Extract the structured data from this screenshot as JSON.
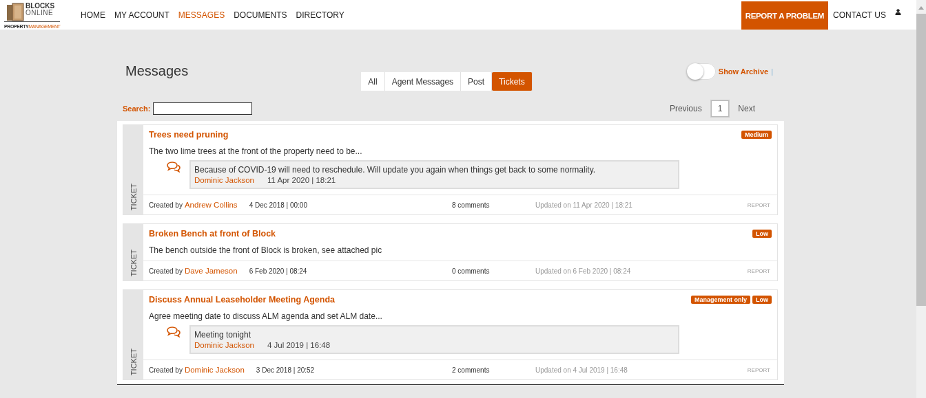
{
  "logo": {
    "name_line_1": "BLOCKS",
    "name_line_2": "ONLINE",
    "tagline_part_1": "PROPERTY",
    "tagline_part_2": "MANAGEMENT"
  },
  "nav": [
    {
      "label": "HOME",
      "selected": false
    },
    {
      "label": "MY ACCOUNT",
      "selected": false
    },
    {
      "label": "MESSAGES",
      "selected": true
    },
    {
      "label": "DOCUMENTS",
      "selected": false
    },
    {
      "label": "DIRECTORY",
      "selected": false
    }
  ],
  "header_actions": {
    "report": "REPORT A PROBLEM",
    "contact": "CONTACT US"
  },
  "page_title": "Messages",
  "archive_toggle": {
    "label": "Show Archive",
    "separator": "|",
    "on": false
  },
  "tabs": [
    {
      "label": "All",
      "selected": false
    },
    {
      "label": "Agent Messages",
      "selected": false
    },
    {
      "label": "Post",
      "selected": false
    },
    {
      "label": "Tickets",
      "selected": true
    }
  ],
  "search": {
    "label": "Search:"
  },
  "pagination": {
    "previous": "Previous",
    "next": "Next",
    "pages": [
      {
        "label": "1",
        "selected": true
      }
    ]
  },
  "tickets": [
    {
      "type_label": "TICKET",
      "title": "Trees need pruning",
      "badges": [
        "Medium"
      ],
      "summary": "The two lime trees at the front of the property need to be...",
      "latest_comment": {
        "text": "Because of COVID-19 will need to reschedule. Will update you again when things get back to some normality.",
        "author": "Dominic Jackson",
        "date": "11 Apr 2020 | 18:21"
      },
      "created_prefix": "Created by",
      "created_by": "Andrew Collins",
      "created_date": "4 Dec 2018 | 00:00",
      "comments": "8 comments",
      "updated": "Updated on 11 Apr 2020 | 18:21",
      "report": "REPORT"
    },
    {
      "type_label": "TICKET",
      "title": "Broken Bench at front of Block",
      "badges": [
        "Low"
      ],
      "summary": "The bench outside the front of Block is broken, see attached pic",
      "created_prefix": "Created by",
      "created_by": "Dave Jameson",
      "created_date": "6 Feb 2020 | 08:24",
      "comments": "0 comments",
      "updated": "Updated on 6 Feb 2020 | 08:24",
      "report": "REPORT"
    },
    {
      "type_label": "TICKET",
      "title": "Discuss Annual Leaseholder Meeting Agenda",
      "badges": [
        "Management only",
        "Low"
      ],
      "summary": "Agree meeting date to discuss ALM agenda and set ALM date...",
      "latest_comment": {
        "text": "Meeting tonight",
        "author": "Dominic Jackson",
        "date": "4 Jul 2019 | 16:48"
      },
      "created_prefix": "Created by",
      "created_by": "Dominic Jackson",
      "created_date": "3 Dec 2018 | 20:52",
      "comments": "2 comments",
      "updated": "Updated on 4 Jul 2019 | 16:48",
      "report": "REPORT"
    }
  ]
}
